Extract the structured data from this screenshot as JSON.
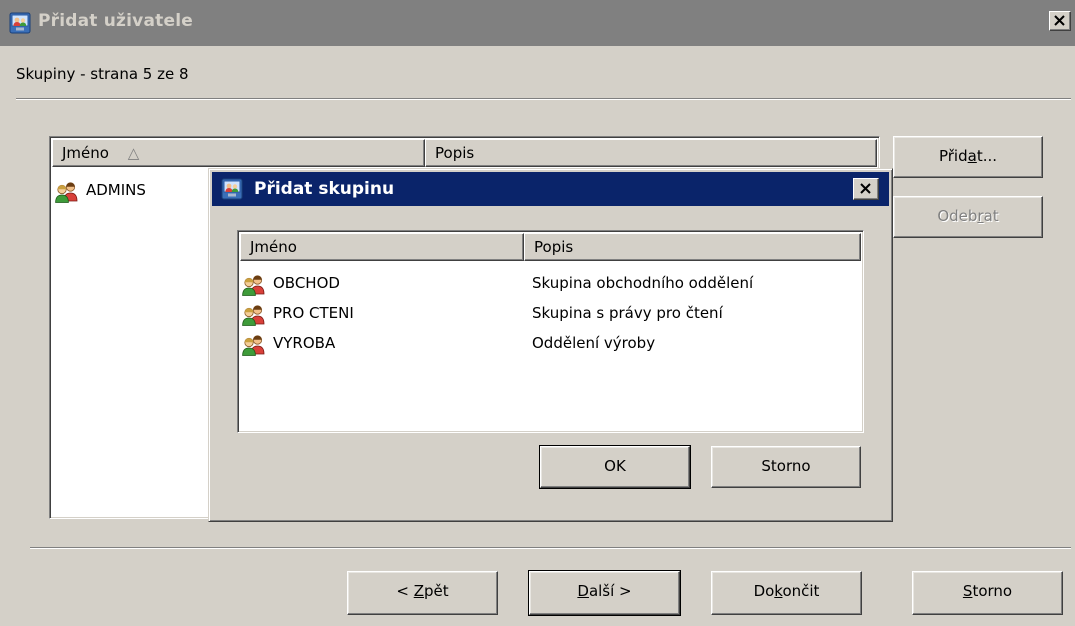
{
  "window": {
    "title": "Přidat uživatele",
    "subtitle": "Skupiny - strana 5 ze 8"
  },
  "main_list": {
    "columns": [
      {
        "label": "Jméno",
        "sort_indicator": "△"
      },
      {
        "label": "Popis"
      }
    ],
    "rows": [
      {
        "name": "ADMINS",
        "description": "",
        "icon": "group-icon"
      }
    ]
  },
  "side_buttons": {
    "add": {
      "pre": "Přid",
      "accel": "a",
      "post": "t..."
    },
    "remove": {
      "pre": "Odeb",
      "accel": "r",
      "post": "at"
    }
  },
  "nav_buttons": {
    "back": {
      "pre": "< ",
      "accel": "Z",
      "post": "pět"
    },
    "next": {
      "pre": "",
      "accel": "D",
      "post": "alší >"
    },
    "finish": {
      "pre": "Do",
      "accel": "k",
      "post": "ončit"
    },
    "cancel": {
      "pre": "",
      "accel": "S",
      "post": "torno"
    }
  },
  "dialog": {
    "title": "Přidat skupinu",
    "columns": [
      {
        "label": "Jméno"
      },
      {
        "label": "Popis"
      }
    ],
    "rows": [
      {
        "name": "OBCHOD",
        "description": "Skupina obchodního oddělení",
        "icon": "group-icon"
      },
      {
        "name": "PRO CTENI",
        "description": "Skupina s právy pro čtení",
        "icon": "group-icon"
      },
      {
        "name": "VYROBA",
        "description": "Oddělení výroby",
        "icon": "group-icon"
      }
    ],
    "ok_label": "OK",
    "cancel_label": "Storno"
  },
  "colors": {
    "face": "#d4d0c8",
    "active_title": "#0a246a",
    "inactive_title": "#808080"
  }
}
